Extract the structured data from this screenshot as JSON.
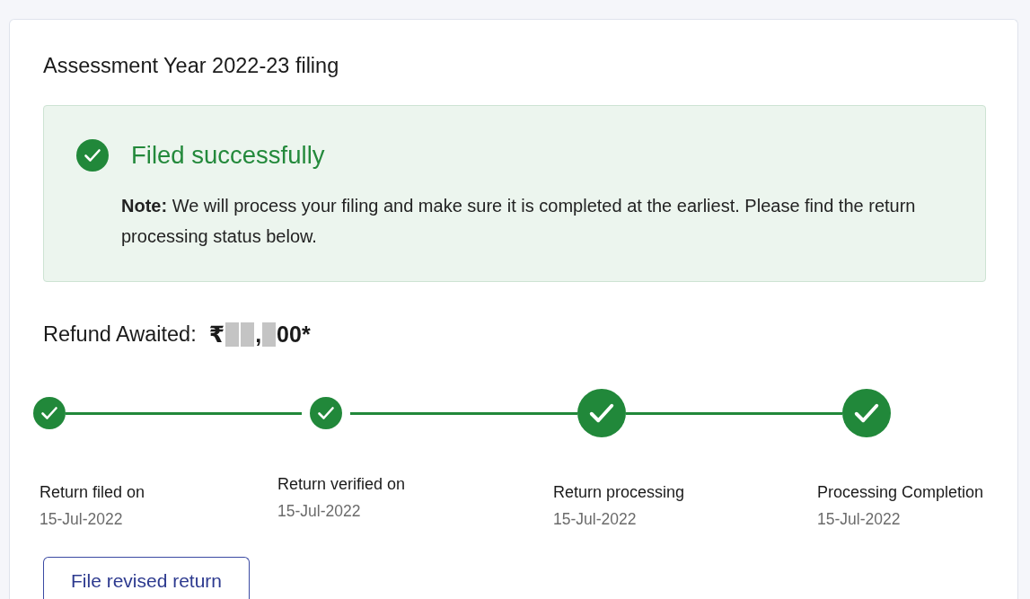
{
  "card": {
    "title": "Assessment Year 2022-23 filing"
  },
  "status_banner": {
    "kind": "success",
    "heading": "Filed successfully",
    "note": "**Note:** We will process your filing and make sure it is completed at the earliest. Please find the return processing status below."
  },
  "refund": {
    "label": "Refund Awaited:",
    "amount": [
      {
        "kind": "text",
        "text": "₹"
      },
      {
        "kind": "redacted"
      },
      {
        "kind": "redacted"
      },
      {
        "kind": "text",
        "text": ","
      },
      {
        "kind": "redacted"
      },
      {
        "kind": "text",
        "text": "00*"
      }
    ]
  },
  "steps": [
    {
      "label": "Return filed on",
      "date": "15-Jul-2022",
      "completed": true,
      "large": false
    },
    {
      "label": "Return verified on",
      "date": "15-Jul-2022",
      "completed": true,
      "large": false
    },
    {
      "label": "Return processing",
      "date": "15-Jul-2022",
      "completed": true,
      "large": true
    },
    {
      "label": "Processing Completion",
      "date": "15-Jul-2022",
      "completed": true,
      "large": true
    }
  ],
  "buttons": [
    {
      "label": "File revised return"
    }
  ]
}
